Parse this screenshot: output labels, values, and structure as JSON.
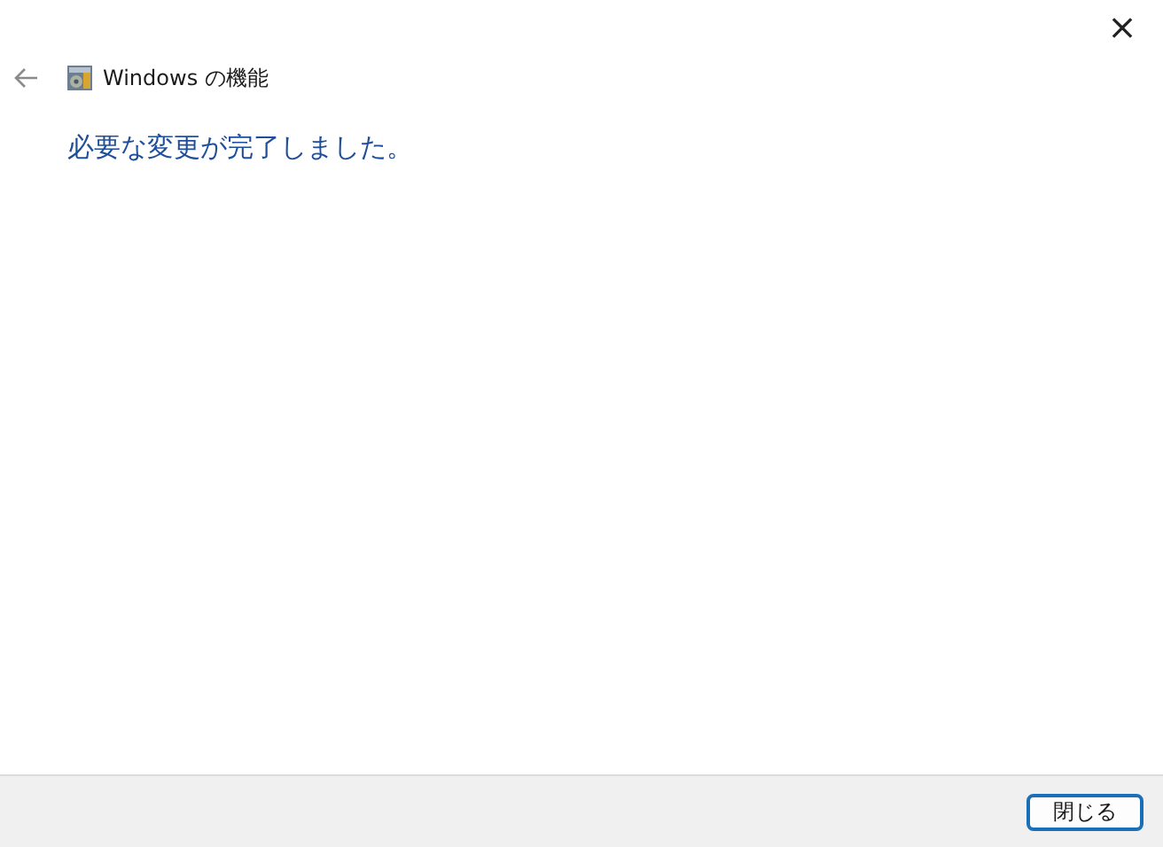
{
  "window": {
    "close_glyph": "×"
  },
  "header": {
    "title": "Windows の機能"
  },
  "message": "必要な変更が完了しました。",
  "footer": {
    "buttons": [
      {
        "label": "閉じる",
        "default": true
      }
    ]
  }
}
